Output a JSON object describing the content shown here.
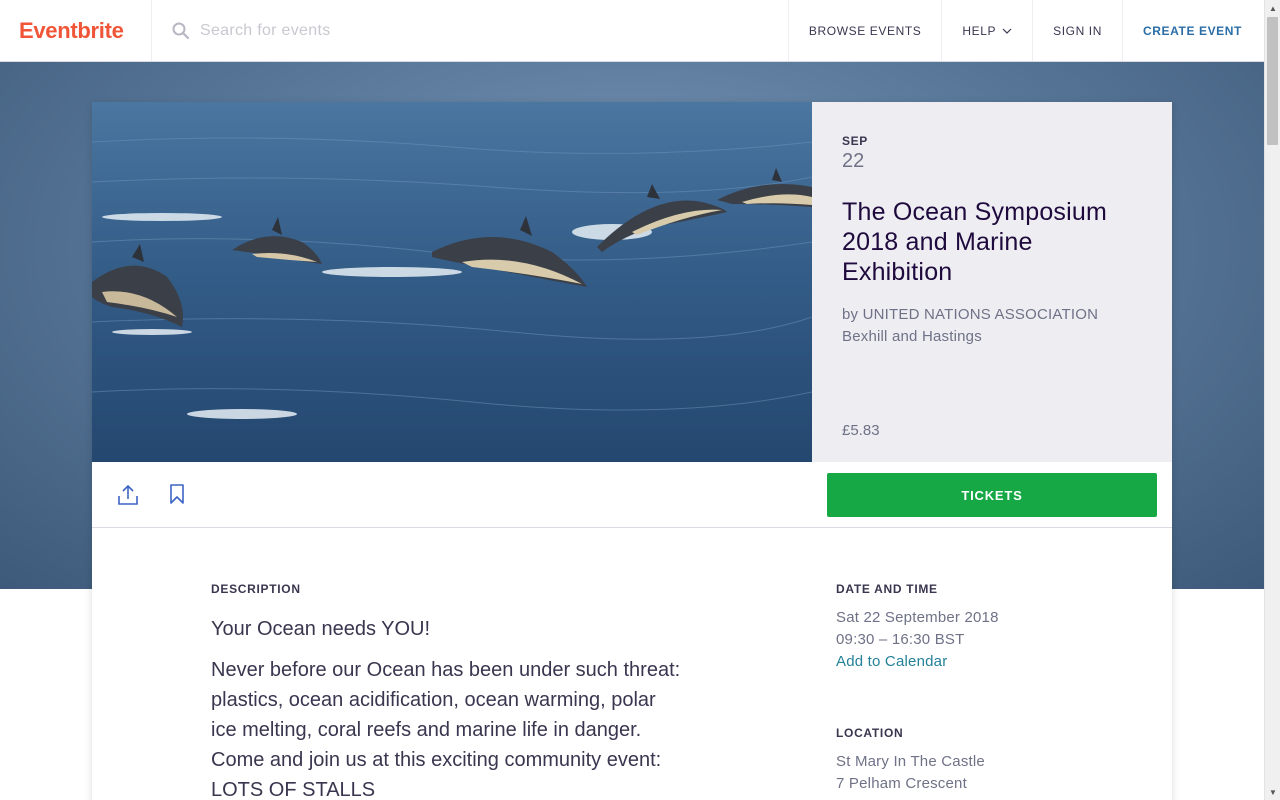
{
  "header": {
    "logo": "Eventbrite",
    "search_placeholder": "Search for events",
    "nav": {
      "browse": "BROWSE EVENTS",
      "help": "HELP",
      "sign_in": "SIGN IN",
      "create": "CREATE EVENT"
    }
  },
  "event": {
    "month": "SEP",
    "day": "22",
    "title": "The Ocean Symposium 2018 and Marine Exhibition",
    "organizer": "by UNITED NATIONS ASSOCIATION Bexhill and Hastings",
    "price": "£5.83",
    "tickets_label": "TICKETS"
  },
  "description": {
    "label": "DESCRIPTION",
    "lead": "Your Ocean needs YOU!",
    "body": "Never before our Ocean has been under such threat: plastics, ocean acidification, ocean warming, polar ice melting, coral reefs and marine life in danger. Come and join us at this exciting community event: LOTS OF STALLS"
  },
  "date_time": {
    "label": "DATE AND TIME",
    "date": "Sat 22 September 2018",
    "time": "09:30 – 16:30 BST",
    "calendar_link": "Add to Calendar"
  },
  "location": {
    "label": "LOCATION",
    "line1": "St Mary In The Castle",
    "line2": "7 Pelham Crescent"
  },
  "colors": {
    "brand": "#f05537",
    "tickets_button": "#15a844",
    "link": "#238199"
  }
}
